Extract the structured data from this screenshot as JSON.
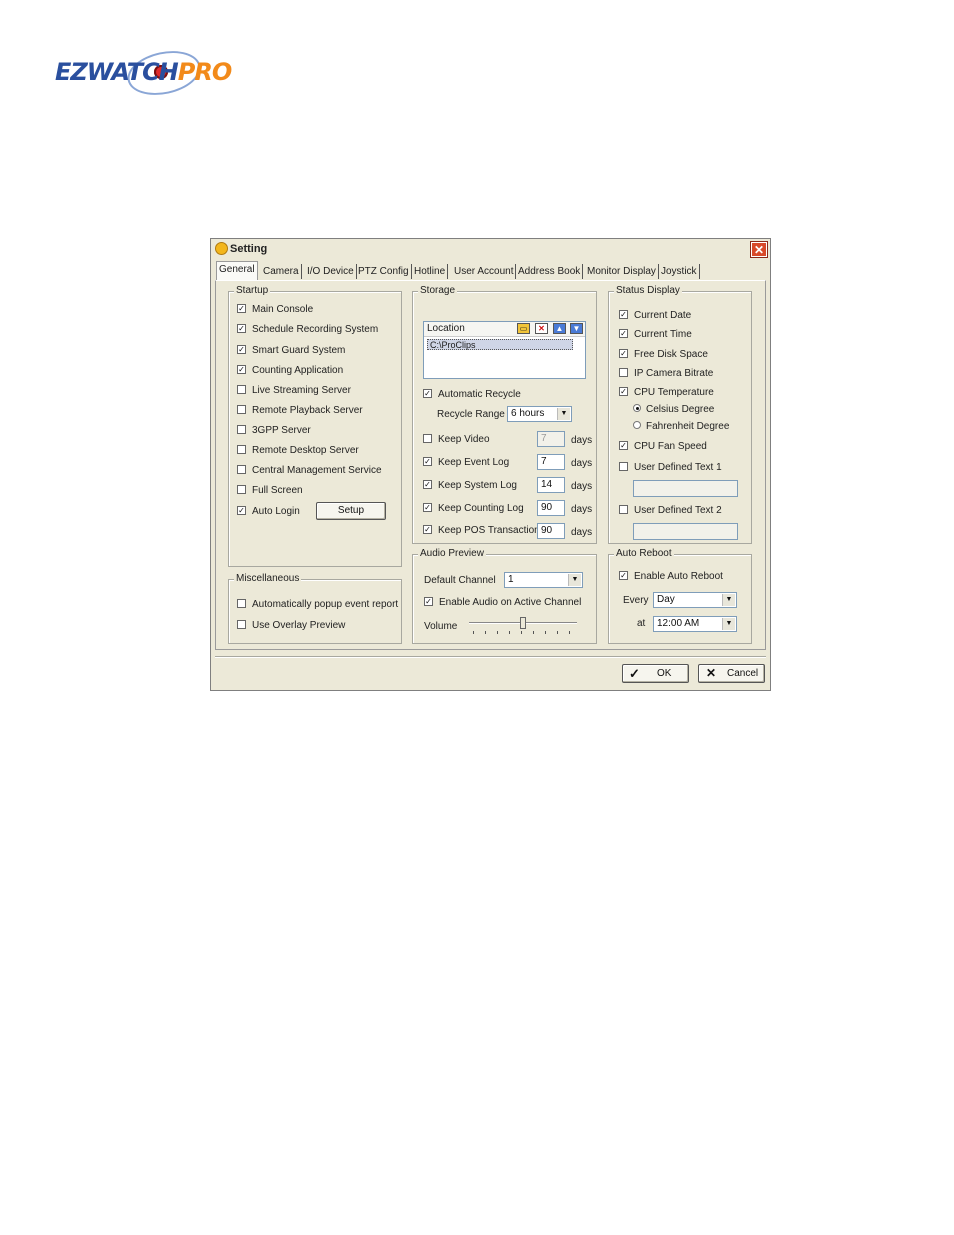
{
  "logo": {
    "ez": "EZWATCH",
    "pro": "PRO"
  },
  "window": {
    "title": "Setting",
    "close": "✕"
  },
  "tabs": [
    "General",
    "Camera",
    "I/O Device",
    "PTZ Config",
    "Hotline",
    "User Account",
    "Address Book",
    "Monitor Display",
    "Joystick"
  ],
  "startup": {
    "legend": "Startup",
    "items": [
      {
        "label": "Main Console",
        "checked": true
      },
      {
        "label": "Schedule Recording System",
        "checked": true
      },
      {
        "label": "Smart Guard System",
        "checked": true
      },
      {
        "label": "Counting Application",
        "checked": true
      },
      {
        "label": "Live Streaming Server",
        "checked": false
      },
      {
        "label": "Remote Playback Server",
        "checked": false
      },
      {
        "label": "3GPP Server",
        "checked": false
      },
      {
        "label": "Remote Desktop Server",
        "checked": false
      },
      {
        "label": "Central Management Service",
        "checked": false
      },
      {
        "label": "Full Screen",
        "checked": false
      },
      {
        "label": "Auto Login",
        "checked": true
      }
    ],
    "setup_button": "Setup"
  },
  "misc": {
    "legend": "Miscellaneous",
    "items": [
      {
        "label": "Automatically popup event report",
        "checked": false
      },
      {
        "label": "Use Overlay Preview",
        "checked": false
      }
    ]
  },
  "storage": {
    "legend": "Storage",
    "location_header": "Location",
    "location_item": "C:\\ProClips",
    "auto_recycle": "Automatic Recycle",
    "recycle_range_label": "Recycle Range",
    "recycle_range_value": "6 hours",
    "days": "days",
    "keep": [
      {
        "label": "Keep Video",
        "value": "7",
        "checked": false,
        "disabled": true
      },
      {
        "label": "Keep Event Log",
        "value": "7",
        "checked": true,
        "disabled": false
      },
      {
        "label": "Keep System Log",
        "value": "14",
        "checked": true,
        "disabled": false
      },
      {
        "label": "Keep Counting Log",
        "value": "90",
        "checked": true,
        "disabled": false
      },
      {
        "label": "Keep POS Transaction",
        "value": "90",
        "checked": true,
        "disabled": false
      }
    ]
  },
  "audio": {
    "legend": "Audio Preview",
    "default_channel_label": "Default Channel",
    "default_channel_value": "1",
    "enable_audio": "Enable Audio on Active Channel",
    "volume_label": "Volume",
    "volume_level": 0.5
  },
  "status": {
    "legend": "Status Display",
    "current_date": "Current Date",
    "current_time": "Current Time",
    "free_disk": "Free Disk Space",
    "ip_bitrate": "IP Camera Bitrate",
    "cpu_temp": "CPU Temperature",
    "celsius": "Celsius Degree",
    "fahrenheit": "Fahrenheit Degree",
    "cpu_fan": "CPU Fan Speed",
    "user_text1": "User Defined Text 1",
    "user_text2": "User Defined Text 2"
  },
  "reboot": {
    "legend": "Auto Reboot",
    "enable": "Enable Auto Reboot",
    "every_label": "Every",
    "every_value": "Day",
    "at_label": "at",
    "at_value": "12:00 AM"
  },
  "footer": {
    "ok": "OK",
    "cancel": "Cancel"
  }
}
